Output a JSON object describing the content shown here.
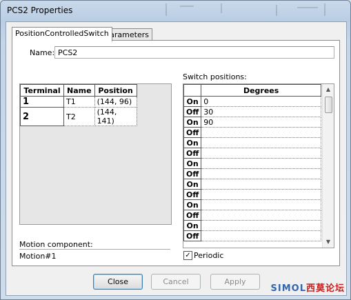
{
  "window": {
    "title": "PCS2 Properties"
  },
  "tabs": [
    {
      "label": "PositionControlledSwitch",
      "active": true
    },
    {
      "label": "Parameters",
      "active": false
    }
  ],
  "name_field": {
    "label": "Name:",
    "value": "PCS2"
  },
  "terminals": {
    "headers": [
      "Terminal",
      "Name",
      "Position"
    ],
    "rows": [
      {
        "terminal": "1",
        "name": "T1",
        "position": "(144, 96)"
      },
      {
        "terminal": "2",
        "name": "T2",
        "position": "(144, 141)"
      }
    ]
  },
  "switch_positions": {
    "label": "Switch positions:",
    "header": "Degrees",
    "rows": [
      {
        "state": "On",
        "degrees": "0"
      },
      {
        "state": "Off",
        "degrees": "30"
      },
      {
        "state": "On",
        "degrees": "90"
      },
      {
        "state": "Off",
        "degrees": ""
      },
      {
        "state": "On",
        "degrees": ""
      },
      {
        "state": "Off",
        "degrees": ""
      },
      {
        "state": "On",
        "degrees": ""
      },
      {
        "state": "Off",
        "degrees": ""
      },
      {
        "state": "On",
        "degrees": ""
      },
      {
        "state": "Off",
        "degrees": ""
      },
      {
        "state": "On",
        "degrees": ""
      },
      {
        "state": "Off",
        "degrees": ""
      },
      {
        "state": "On",
        "degrees": ""
      },
      {
        "state": "Off",
        "degrees": ""
      }
    ]
  },
  "motion": {
    "label": "Motion component:",
    "value": "Motion#1"
  },
  "periodic": {
    "label": "Periodic",
    "checked": true
  },
  "buttons": {
    "close": "Close",
    "cancel": "Cancel",
    "apply": "Apply"
  },
  "watermark": {
    "text_blue": "SIMOL",
    "text_red": "西莫论坛"
  }
}
